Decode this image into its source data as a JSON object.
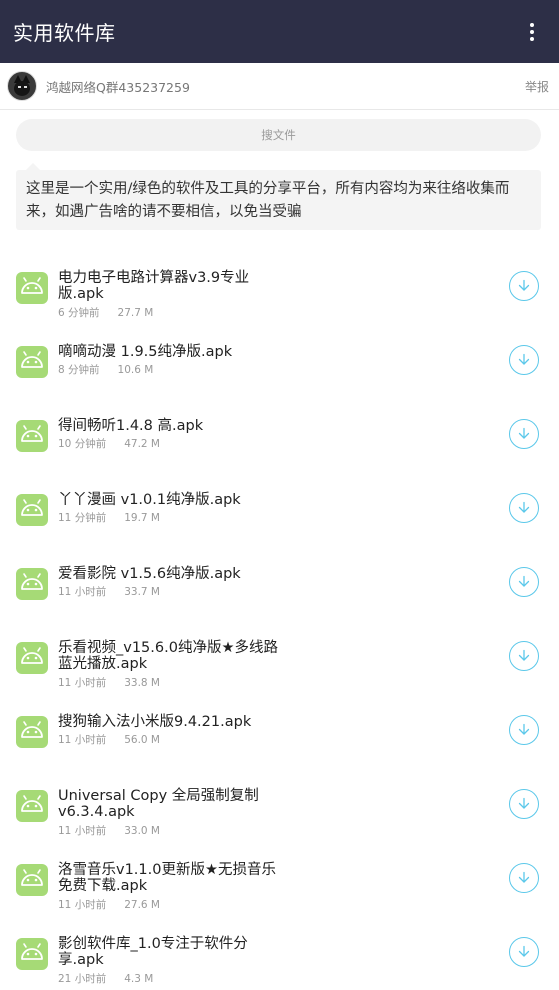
{
  "app": {
    "title": "实用软件库"
  },
  "user": {
    "name": "鸿越网络Q群435237259",
    "report_label": "举报"
  },
  "search": {
    "placeholder": "搜文件"
  },
  "notice": {
    "text": "这里是一个实用/绿色的软件及工具的分享平台，所有内容均为来往络收集而来，如遇广告啥的请不要相信，以免当受骗"
  },
  "colors": {
    "appbar": "#2d2f47",
    "android_icon": "#a6da76",
    "download_accent": "#5bc8ea"
  },
  "icons": {
    "menu": "more-vert-icon",
    "file": "android-icon",
    "download": "download-circle-icon"
  },
  "files": [
    {
      "name": "电力电子电路计算器v3.9专业版.apk",
      "time": "6 分钟前",
      "size": "27.7 M"
    },
    {
      "name": "嘀嘀动漫 1.9.5纯净版.apk",
      "time": "8 分钟前",
      "size": "10.6 M"
    },
    {
      "name": "得间畅听1.4.8 高.apk",
      "time": "10 分钟前",
      "size": "47.2 M"
    },
    {
      "name": "丫丫漫画 v1.0.1纯净版.apk",
      "time": "11 分钟前",
      "size": "19.7 M"
    },
    {
      "name": "爱看影院 v1.5.6纯净版.apk",
      "time": "11 小时前",
      "size": "33.7 M"
    },
    {
      "name": "乐看视频_v15.6.0纯净版★多线路蓝光播放.apk",
      "time": "11 小时前",
      "size": "33.8 M"
    },
    {
      "name": "搜狗输入法小米版9.4.21.apk",
      "time": "11 小时前",
      "size": "56.0 M"
    },
    {
      "name": "Universal Copy 全局强制复制v6.3.4.apk",
      "time": "11 小时前",
      "size": "33.0 M"
    },
    {
      "name": "洛雪音乐v1.1.0更新版★无损音乐免费下载.apk",
      "time": "11 小时前",
      "size": "27.6 M"
    },
    {
      "name": "影创软件库_1.0专注于软件分享.apk",
      "time": "21 小时前",
      "size": "4.3 M"
    }
  ]
}
